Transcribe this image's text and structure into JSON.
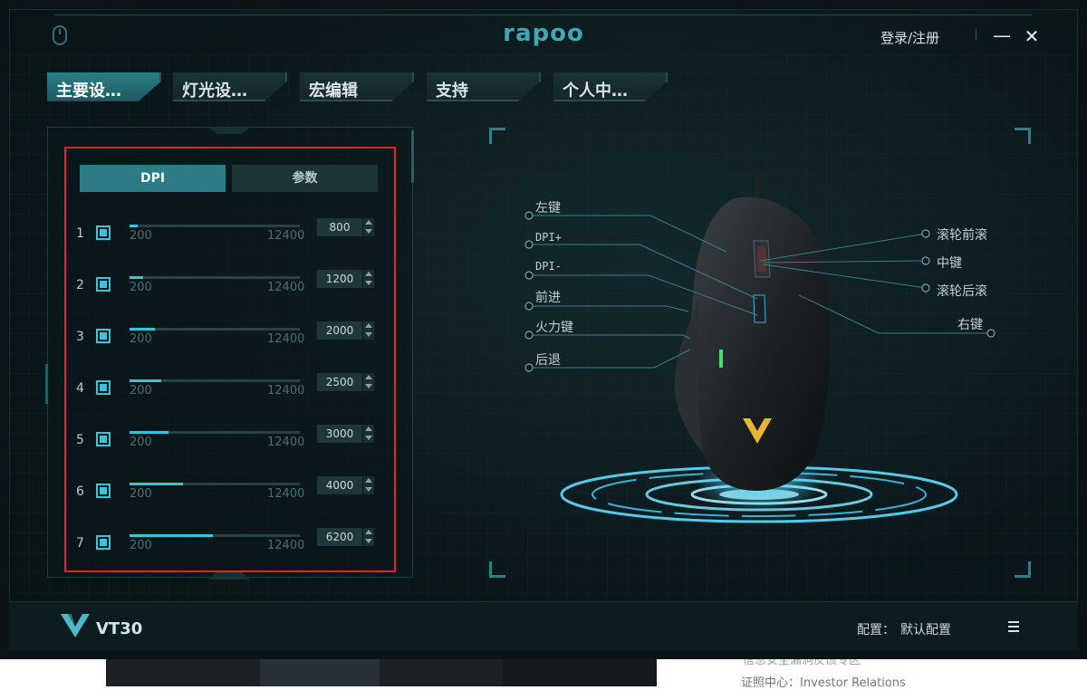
{
  "window": {
    "brand": "rapoo",
    "login_text": "登录/注册",
    "minimize_symbol": "—",
    "close_symbol": "✕"
  },
  "tabs": [
    {
      "label": "主要设…",
      "active": true
    },
    {
      "label": "灯光设…",
      "active": false
    },
    {
      "label": "宏编辑",
      "active": false
    },
    {
      "label": "支持",
      "active": false
    },
    {
      "label": "个人中…",
      "active": false
    }
  ],
  "dpi_panel": {
    "segments": {
      "dpi": "DPI",
      "params": "参数"
    },
    "range": {
      "min": "200",
      "max": "12400"
    },
    "levels": [
      {
        "index": "1",
        "value": "800"
      },
      {
        "index": "2",
        "value": "1200"
      },
      {
        "index": "3",
        "value": "2000"
      },
      {
        "index": "4",
        "value": "2500"
      },
      {
        "index": "5",
        "value": "3000"
      },
      {
        "index": "6",
        "value": "4000"
      },
      {
        "index": "7",
        "value": "6200"
      }
    ]
  },
  "mouse_buttons": {
    "left": [
      "左键",
      "DPI+",
      "DPI-",
      "前进",
      "火力键",
      "后退"
    ],
    "right": [
      "滚轮前滚",
      "中键",
      "滚轮后滚",
      "右键"
    ]
  },
  "footer": {
    "model": "VT30",
    "config_label": "配置：",
    "config_value": "默认配置"
  },
  "background_page": {
    "text_1": "信息安全漏洞反馈专区",
    "text_2": "证照中心：Investor Relations"
  },
  "colors": {
    "accent": "#3ac4d8",
    "tab_active": "#2b7c86",
    "highlight_box": "#e0262b",
    "glow": "#48d7ff"
  },
  "icons": {
    "device": "mouse-icon",
    "menu": "hamburger-menu-icon",
    "logo": "v-logo-icon"
  }
}
